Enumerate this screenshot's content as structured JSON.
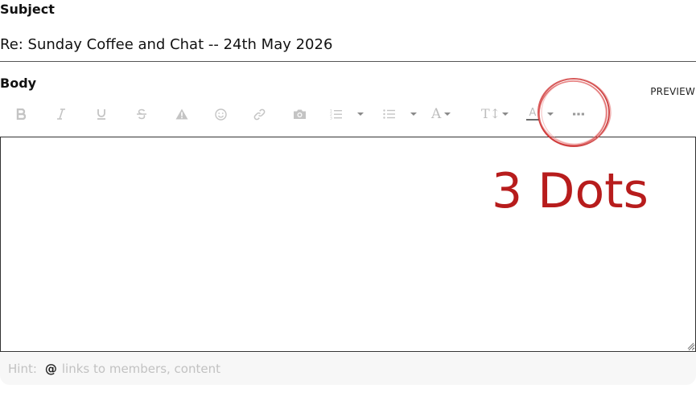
{
  "subject": {
    "label": "Subject",
    "value": "Re: Sunday Coffee and Chat -- 24th May 2026"
  },
  "body": {
    "label": "Body",
    "preview_label": "PREVIEW",
    "content": ""
  },
  "toolbar": {
    "buttons": [
      {
        "icon": "bold-icon"
      },
      {
        "icon": "italic-icon"
      },
      {
        "icon": "underline-icon"
      },
      {
        "icon": "strikethrough-icon"
      },
      {
        "icon": "warning-icon"
      },
      {
        "icon": "emoji-icon"
      },
      {
        "icon": "link-icon"
      },
      {
        "icon": "camera-icon"
      },
      {
        "icon": "numbered-list-icon",
        "dropdown": true
      },
      {
        "icon": "bulleted-list-icon",
        "dropdown": true
      },
      {
        "icon": "font-family-icon",
        "dropdown": true
      },
      {
        "icon": "font-size-icon",
        "dropdown": true
      },
      {
        "icon": "text-color-icon",
        "dropdown": true
      },
      {
        "icon": "more-options-icon"
      }
    ],
    "glyphs": {
      "font_family": "A",
      "font_size": "T↕",
      "text_color": "A"
    }
  },
  "hint": {
    "label": "Hint:",
    "at_symbol": "@",
    "text": "links to members, content"
  },
  "annotation": {
    "label": "3 Dots",
    "color": "#b71c1c"
  },
  "colors": {
    "toolbar_icon": "#c4c4c4",
    "annotation": "#b71c1c"
  }
}
